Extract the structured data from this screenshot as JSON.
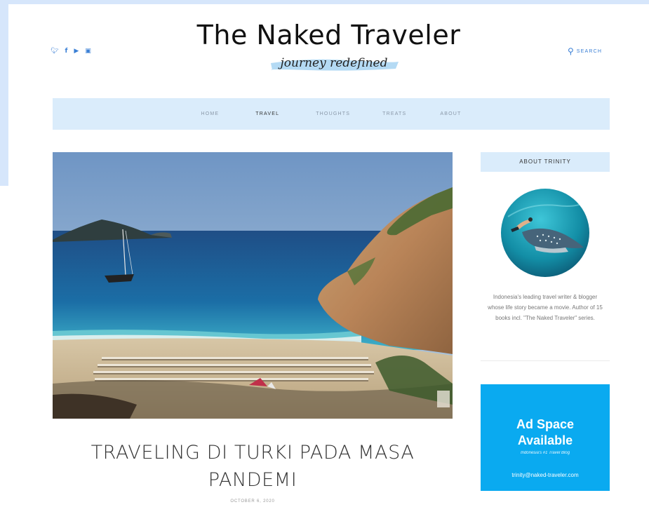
{
  "header": {
    "site_title": "The Naked Traveler",
    "tagline": "journey redefined",
    "social_icons": [
      "twitter-icon",
      "facebook-icon",
      "youtube-icon",
      "instagram-icon"
    ],
    "search_label": "SEARCH"
  },
  "nav": {
    "items": [
      {
        "label": "HOME",
        "active": false
      },
      {
        "label": "TRAVEL",
        "active": true
      },
      {
        "label": "THOUGHTS",
        "active": false
      },
      {
        "label": "TREATS",
        "active": false
      },
      {
        "label": "ABOUT",
        "active": false
      }
    ]
  },
  "post": {
    "title": "TRAVELING DI TURKI PADA MASA PANDEMI",
    "date": "OCTOBER 6, 2020"
  },
  "sidebar": {
    "about_heading": "ABOUT TRINITY",
    "bio": "Indonesia's leading travel writer & blogger whose life story became a movie. Author of 15 books incl. \"The Naked Traveler\" series.",
    "ad": {
      "title_line1": "Ad Space",
      "title_line2": "Available",
      "subtitle": "Indonesia's #1 Travel Blog",
      "email": "trinity@naked-traveler.com"
    }
  },
  "colors": {
    "accent_blue": "#3a7fd5",
    "nav_bg": "#daecfb",
    "ad_bg": "#0aaaf0"
  }
}
